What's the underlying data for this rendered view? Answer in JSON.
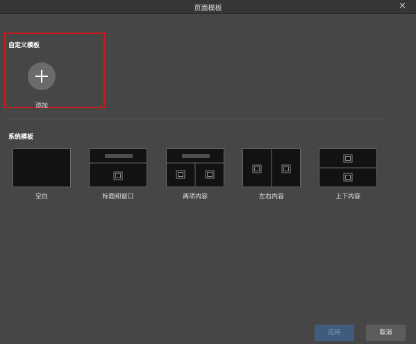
{
  "dialog": {
    "title": "页面模板",
    "close_icon": "×"
  },
  "custom": {
    "heading": "自定义模板",
    "add_label": "添加"
  },
  "system": {
    "heading": "系统模板",
    "templates": [
      {
        "label": "空白"
      },
      {
        "label": "标题和窗口"
      },
      {
        "label": "两项内容"
      },
      {
        "label": "左右内容"
      },
      {
        "label": "上下内容"
      }
    ]
  },
  "buttons": {
    "apply": "应用",
    "cancel": "取消"
  },
  "colors": {
    "highlight": "#d0181c",
    "apply_button": "#3f5b7e",
    "background": "#464646"
  }
}
